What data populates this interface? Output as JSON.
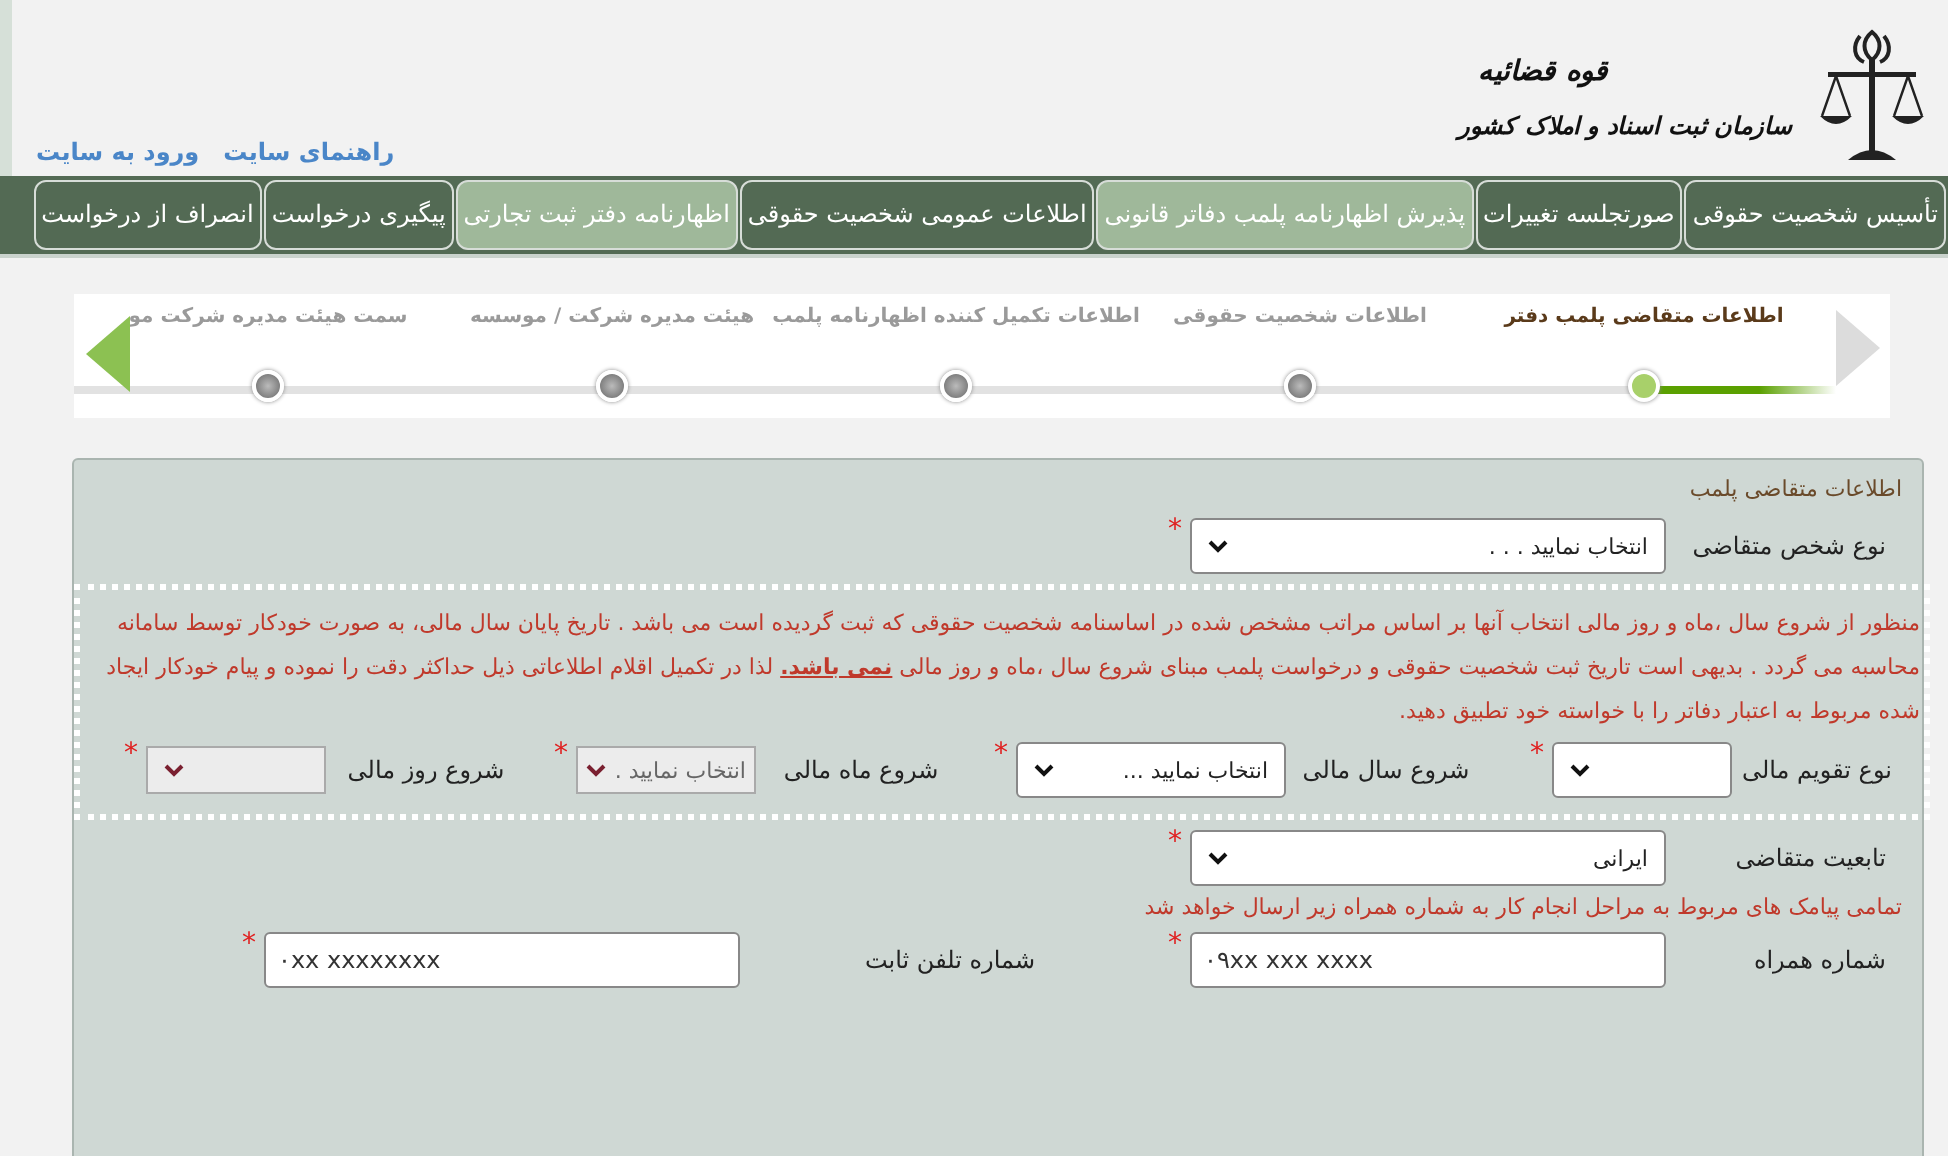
{
  "header": {
    "org_title": "قوه قضائیه",
    "org_name": "سازمان ثبت اسناد و املاک کشور",
    "links": [
      "راهنمای سایت",
      "ورود به سایت"
    ]
  },
  "nav_tabs": [
    {
      "label": "تأسیس شخصیت حقوقی",
      "highlighted": false
    },
    {
      "label": "صورتجلسه تغییرات",
      "highlighted": false
    },
    {
      "label": "پذیرش اظهارنامه پلمب دفاتر قانونی",
      "highlighted": true
    },
    {
      "label": "اطلاعات عمومی شخصیت حقوقی",
      "highlighted": false
    },
    {
      "label": "اظهارنامه دفتر ثبت تجارتی",
      "highlighted": true
    },
    {
      "label": "پیگیری درخواست",
      "highlighted": false
    },
    {
      "label": "انصراف از درخواست",
      "highlighted": false
    }
  ],
  "wizard_steps": [
    {
      "label": "اطلاعات متقاضی پلمب دفتر",
      "selected": true
    },
    {
      "label": "اطلاعات شخصیت حقوقی",
      "selected": false
    },
    {
      "label": "اطلاعات تکمیل کننده اظهارنامه پلمب",
      "selected": false
    },
    {
      "label": "هیئت مدیره شرکت / موسسه",
      "selected": false
    },
    {
      "label": "سمت هیئت مدیره شرکت مو",
      "selected": false
    }
  ],
  "panel": {
    "title": "اطلاعات متقاضی پلمب",
    "applicant_type": {
      "label": "نوع شخص متقاضی",
      "value": "انتخاب نمایید . . .",
      "required_mark": "*"
    },
    "notice": "منظور از شروع سال ،ماه و روز مالی انتخاب آنها بر اساس مراتب مشخص شده در اساسنامه شخصیت حقوقی که ثبت گردیده است می باشد . تاریخ پایان سال مالی، به صورت خودکار توسط سامانه محاسبه می گردد . بدیهی است تاریخ ثبت شخصیت حقوقی و درخواست پلمب مبنای شروع سال ،ماه و روز مالی **نمی باشد.** لذا در تکمیل اقلام اطلاعاتی ذیل حداکثر دقت را نموده و پیام خودکار ایجاد شده مربوط به اعتبار دفاتر را با خواسته خود تطبیق دهید.",
    "fiscal_fields": [
      {
        "label": "نوع تقویم مالی",
        "disabled": false,
        "required_mark": "*"
      },
      {
        "label": "شروع سال مالی",
        "value": "انتخاب نمایید ...",
        "disabled": false,
        "required_mark": "*"
      },
      {
        "label": "شروع ماه مالی",
        "value": "انتخاب نمایید .",
        "disabled": true,
        "required_mark": "*"
      },
      {
        "label": "شروع روز مالی",
        "disabled": true,
        "required_mark": "*"
      }
    ],
    "nationality": {
      "label": "تابعیت متقاضی",
      "value": "ایرانی",
      "required_mark": "*"
    },
    "sms_note": "تمامی پیامک های مربوط به مراحل انجام کار به شماره همراه زیر ارسال خواهد شد",
    "phone_fields": [
      {
        "label": "شماره همراه",
        "placeholder": "۰۹xx xxx xxxx",
        "required_mark": "*"
      },
      {
        "label": "شماره تلفن ثابت",
        "placeholder": "۰xx xxxxxxxx",
        "required_mark": "*"
      }
    ]
  }
}
